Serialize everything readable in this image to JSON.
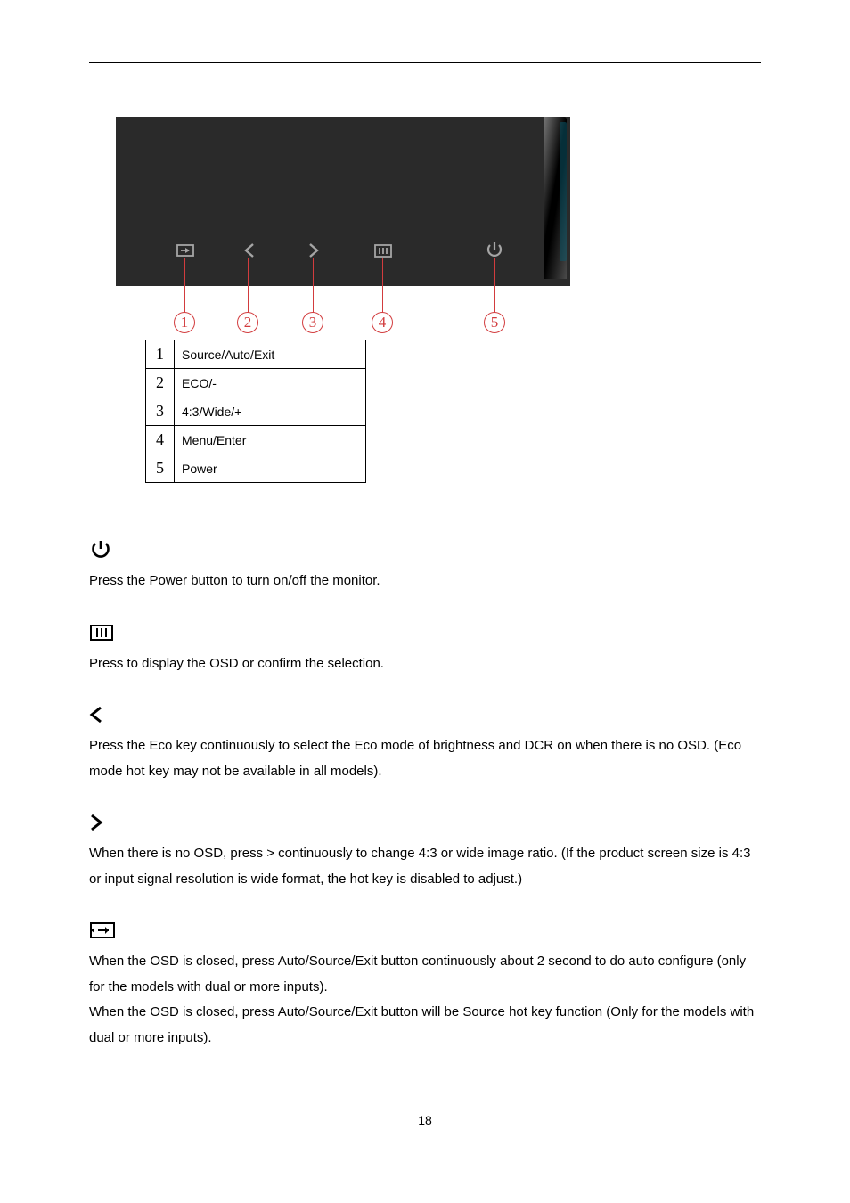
{
  "legend": {
    "rows": [
      {
        "num": "1",
        "desc": "Source/Auto/Exit"
      },
      {
        "num": "2",
        "desc": "ECO/-"
      },
      {
        "num": "3",
        "desc": "4:3/Wide/+"
      },
      {
        "num": "4",
        "desc": "Menu/Enter"
      },
      {
        "num": "5",
        "desc": "Power"
      }
    ]
  },
  "callouts": {
    "n1": "1",
    "n2": "2",
    "n3": "3",
    "n4": "4",
    "n5": "5"
  },
  "sections": {
    "power": "Press the Power button to turn on/off the monitor.",
    "menu": "Press to display the OSD or confirm the selection.",
    "eco": "Press the Eco key continuously to select the Eco mode of brightness and DCR on when there is no OSD. (Eco mode hot key may not be available in all models).",
    "ratio": "When there is no OSD, press > continuously to change 4:3 or wide image ratio. (If the product screen size is 4:3 or input signal resolution is wide format, the hot key is disabled to adjust.)",
    "source1": "When the OSD is closed, press Auto/Source/Exit button continuously about 2 second to do auto configure (only for the models with dual or more inputs).",
    "source2": "When the OSD is closed, press Auto/Source/Exit button will be Source hot key function (Only for the models with dual or more inputs)."
  },
  "pageNumber": "18"
}
